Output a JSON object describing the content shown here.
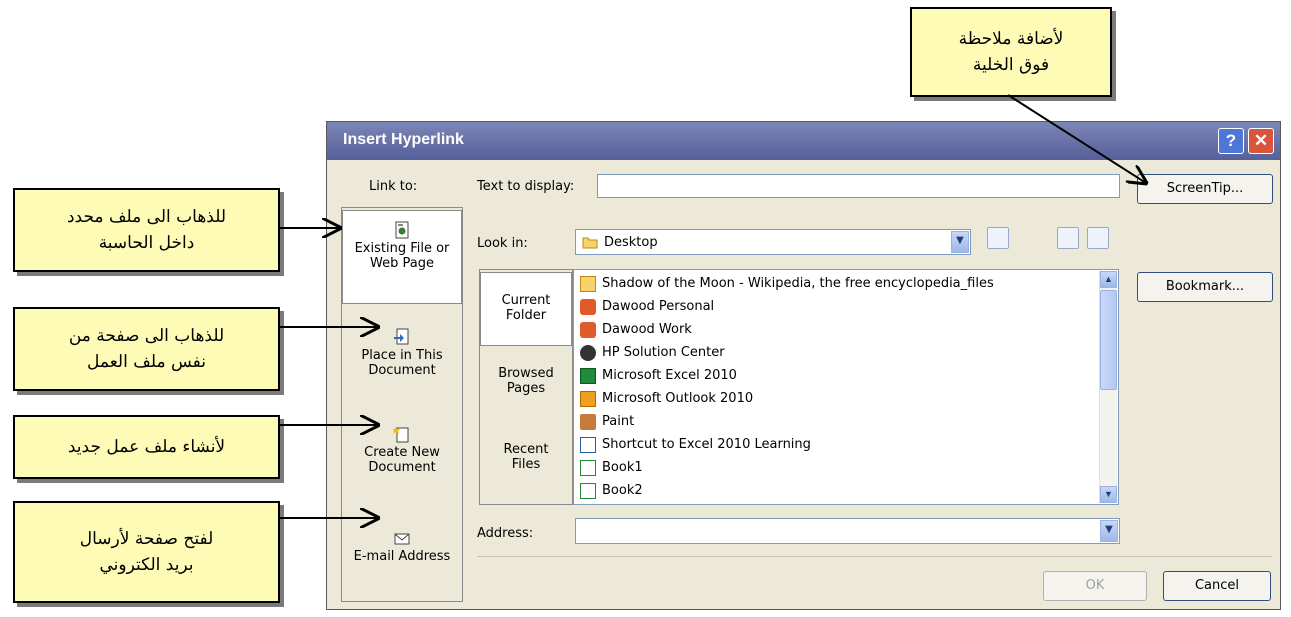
{
  "callouts": {
    "screentip": [
      "لأضافة ملاحظة",
      "فوق الخلية"
    ],
    "existing_file": [
      "للذهاب الى ملف محدد",
      "داخل الحاسبة"
    ],
    "place_in_doc": [
      "للذهاب الى صفحة من",
      "نفس ملف العمل"
    ],
    "new_doc": [
      "لأنشاء ملف عمل جديد"
    ],
    "email": [
      "لفتح صفحة لأرسال",
      "بريد الكتروني"
    ]
  },
  "dialog": {
    "title": "Insert Hyperlink",
    "help_label": "?",
    "close_label": "✕",
    "link_to_label": "Link to:",
    "link_to_items": [
      {
        "line1": "Existing File or",
        "line2": "Web Page",
        "icon": "existing-file-icon",
        "selected": true
      },
      {
        "line1": "Place in This",
        "line2": "Document",
        "icon": "place-in-document-icon",
        "selected": false
      },
      {
        "line1": "Create New",
        "line2": "Document",
        "icon": "new-document-icon",
        "selected": false
      },
      {
        "line1": "E-mail Address",
        "line2": "",
        "icon": "email-icon",
        "selected": false
      }
    ],
    "text_to_display_label": "Text to display:",
    "text_to_display_value": "",
    "screentip_label": "ScreenTip...",
    "look_in_label": "Look in:",
    "look_in_value": "Desktop",
    "bookmark_label": "Bookmark...",
    "tabs": [
      {
        "line1": "Current",
        "line2": "Folder",
        "selected": true
      },
      {
        "line1": "Browsed",
        "line2": "Pages",
        "selected": false
      },
      {
        "line1": "Recent",
        "line2": "Files",
        "selected": false
      }
    ],
    "files": [
      {
        "name": "Shadow of the Moon - Wikipedia, the free encyclopedia_files",
        "icon": "folder-icon"
      },
      {
        "name": "Dawood Personal",
        "icon": "shortcut-icon"
      },
      {
        "name": "Dawood Work",
        "icon": "shortcut-icon"
      },
      {
        "name": "HP Solution Center",
        "icon": "hp-icon"
      },
      {
        "name": "Microsoft Excel 2010",
        "icon": "excel-icon"
      },
      {
        "name": "Microsoft Outlook 2010",
        "icon": "outlook-icon"
      },
      {
        "name": "Paint",
        "icon": "paint-icon"
      },
      {
        "name": "Shortcut to Excel 2010 Learning",
        "icon": "word-icon"
      },
      {
        "name": "Book1",
        "icon": "excel-book-icon"
      },
      {
        "name": "Book2",
        "icon": "excel-book-icon"
      }
    ],
    "address_label": "Address:",
    "address_value": "",
    "ok_label": "OK",
    "cancel_label": "Cancel"
  },
  "colors": {
    "callout_bg": "#fdfbb6",
    "title_bar": "#5d67a0",
    "dialog_bg": "#ece9d8"
  }
}
